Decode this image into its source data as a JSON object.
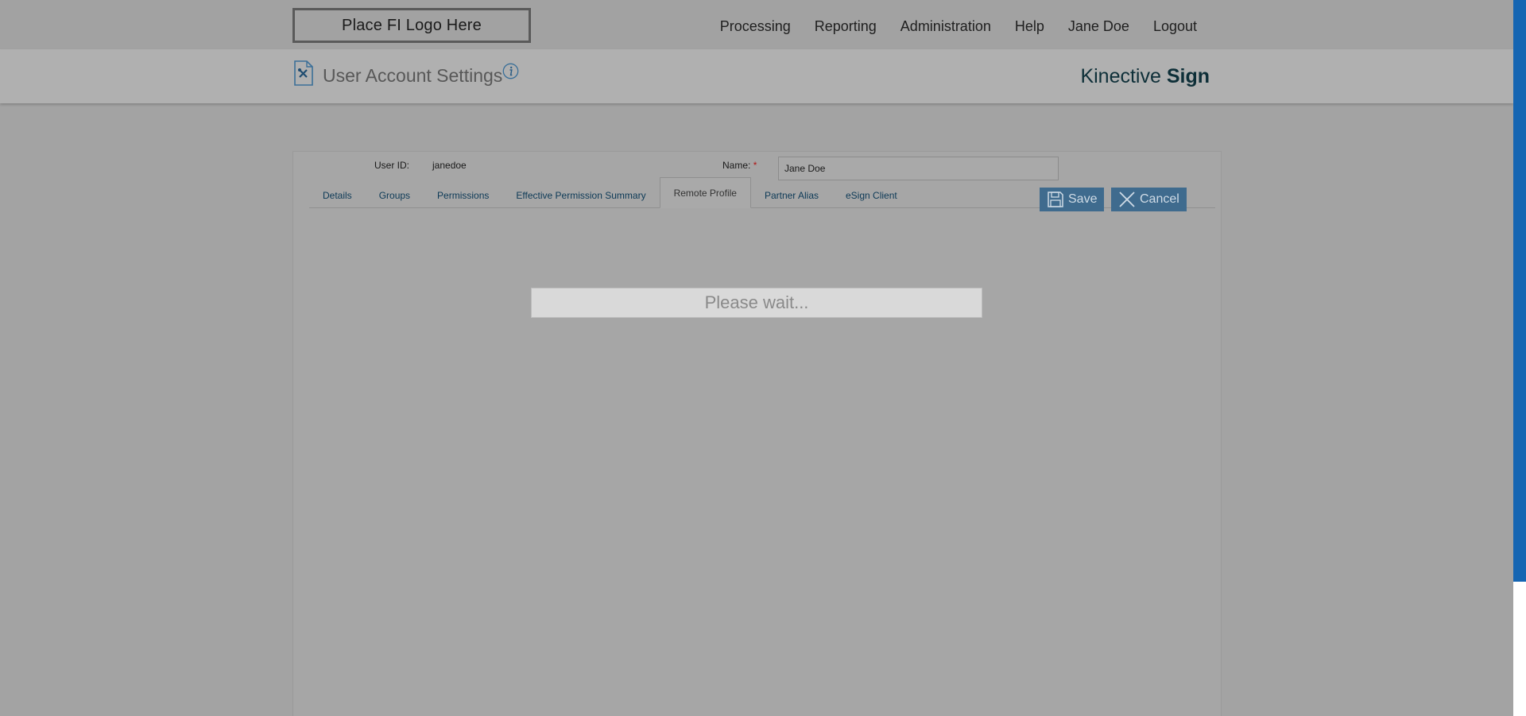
{
  "header": {
    "logo_text": "Place FI Logo Here",
    "nav": [
      "Processing",
      "Reporting",
      "Administration",
      "Help",
      "Jane Doe",
      "Logout"
    ]
  },
  "subheader": {
    "title": "User Account Settings",
    "brand_light": "Kinective ",
    "brand_bold": "Sign"
  },
  "form": {
    "user_id_label": "User ID:",
    "user_id_value": "janedoe",
    "name_label": "Name:",
    "required_mark": "*",
    "name_value": "Jane Doe"
  },
  "tabs": [
    "Details",
    "Groups",
    "Permissions",
    "Effective Permission Summary",
    "Remote Profile",
    "Partner Alias",
    "eSign Client"
  ],
  "active_tab": "Remote Profile",
  "buttons": {
    "save": "Save",
    "cancel": "Cancel"
  },
  "loading_text": "Please wait...",
  "colors": {
    "button_bg": "#3f6b8e",
    "scroll_thumb": "#1565b2",
    "brand_text": "#0e2f38"
  }
}
